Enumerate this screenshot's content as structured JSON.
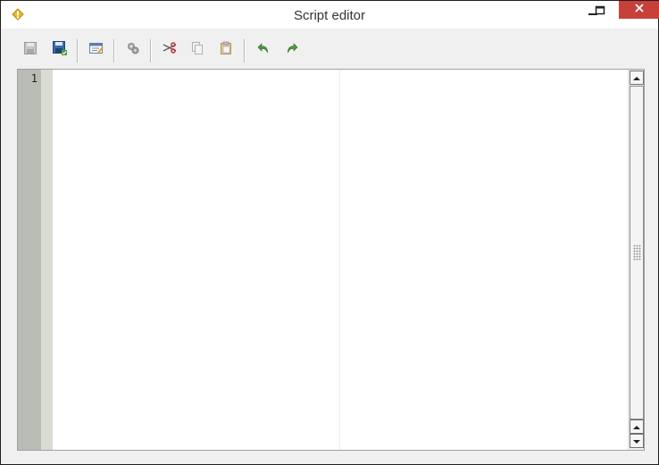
{
  "window": {
    "title": "Script editor",
    "app_icon": "python-logo-icon",
    "controls": [
      "minimize-icon",
      "maximize-icon",
      "close-icon"
    ]
  },
  "toolbar": {
    "buttons": [
      {
        "name": "save-button",
        "icon": "save-icon",
        "enabled": false
      },
      {
        "name": "save-as-button",
        "icon": "save-as-icon",
        "enabled": true
      },
      {
        "name": "edit-script-button",
        "icon": "edit-script-icon",
        "enabled": true
      },
      {
        "name": "run-script-button",
        "icon": "gears-icon",
        "enabled": false
      },
      {
        "name": "cut-button",
        "icon": "scissors-icon",
        "enabled": true
      },
      {
        "name": "copy-button",
        "icon": "copy-icon",
        "enabled": false
      },
      {
        "name": "paste-button",
        "icon": "paste-icon",
        "enabled": false
      },
      {
        "name": "undo-button",
        "icon": "undo-arrow-icon",
        "enabled": true
      },
      {
        "name": "redo-button",
        "icon": "redo-arrow-icon",
        "enabled": true
      }
    ]
  },
  "editor": {
    "line_numbers": [
      "1"
    ],
    "content": ""
  },
  "colors": {
    "close_button": "#c7413a",
    "gutter": "#b9bcb5",
    "fold_margin": "#d8dcd3",
    "undo_redo": "#4a9a3c"
  }
}
